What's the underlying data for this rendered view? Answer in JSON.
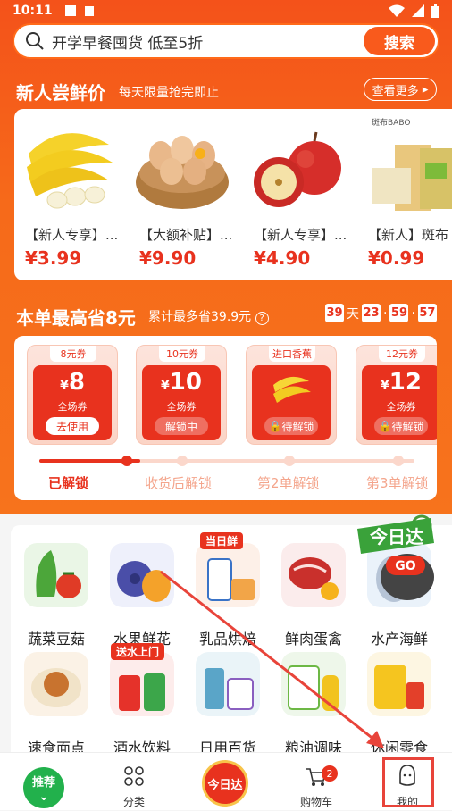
{
  "status_bar": {
    "time": "10:11"
  },
  "search": {
    "placeholder": "开学早餐囤货 低至5折",
    "button": "搜索"
  },
  "new_user": {
    "title": "新人尝鲜价",
    "subtitle": "每天限量抢完即止",
    "see_more": "查看更多",
    "brand_text": "斑布BABO",
    "products": [
      {
        "name": "【新人专享】...",
        "price": "¥3.99",
        "icon": "banana-image"
      },
      {
        "name": "【大额补贴】...",
        "price": "¥9.90",
        "icon": "eggs-image"
      },
      {
        "name": "【新人专享】...",
        "price": "¥4.90",
        "icon": "apple-image"
      },
      {
        "name": "【新人】斑布",
        "price": "¥0.99",
        "icon": "tissue-image"
      }
    ]
  },
  "savings": {
    "title": "本单最高省8元",
    "subtitle": "累计最多省39.9元",
    "countdown": {
      "days": "39",
      "day_unit": "天",
      "hours": "23",
      "minutes": "59",
      "seconds": "57"
    },
    "coupons": [
      {
        "tag": "8元券",
        "currency": "¥",
        "amount": "8",
        "scope": "全场券",
        "action": "去使用"
      },
      {
        "tag": "10元券",
        "currency": "¥",
        "amount": "10",
        "scope": "全场券",
        "action": "解锁中"
      },
      {
        "tag": "进口香蕉",
        "currency": "",
        "amount": "",
        "scope": "",
        "action": "待解锁"
      },
      {
        "tag": "12元券",
        "currency": "¥",
        "amount": "12",
        "scope": "全场券",
        "action": "待解锁"
      }
    ],
    "stages": [
      "已解锁",
      "收货后解锁",
      "第2单解锁",
      "第3单解锁"
    ],
    "progress_fraction": 0.27
  },
  "categories": [
    {
      "label": "蔬菜豆菇",
      "icon": "vegetables-icon"
    },
    {
      "label": "水果鲜花",
      "icon": "fruit-icon"
    },
    {
      "label": "乳品烘焙",
      "icon": "dairy-icon",
      "badge": "当日鲜"
    },
    {
      "label": "鲜肉蛋禽",
      "icon": "meat-icon"
    },
    {
      "label": "水产海鲜",
      "icon": "seafood-icon"
    },
    {
      "label": "速食面点",
      "icon": "dumpling-icon"
    },
    {
      "label": "酒水饮料",
      "icon": "drinks-icon",
      "badge": "送水上门"
    },
    {
      "label": "日用百货",
      "icon": "household-icon"
    },
    {
      "label": "粮油调味",
      "icon": "rice-oil-icon"
    },
    {
      "label": "休闲零食",
      "icon": "snacks-icon"
    }
  ],
  "today_promo": {
    "text": "今日达",
    "go": "GO"
  },
  "bottom_nav": [
    {
      "label": "推荐",
      "icon": "recommend-icon"
    },
    {
      "label": "分类",
      "icon": "category-icon"
    },
    {
      "label": "今日达",
      "icon": "today-delivery-icon"
    },
    {
      "label": "购物车",
      "icon": "cart-icon",
      "badge": "2"
    },
    {
      "label": "我的",
      "icon": "profile-icon"
    }
  ],
  "colors": {
    "accent": "#e8321e",
    "header": "#f55a1a"
  }
}
